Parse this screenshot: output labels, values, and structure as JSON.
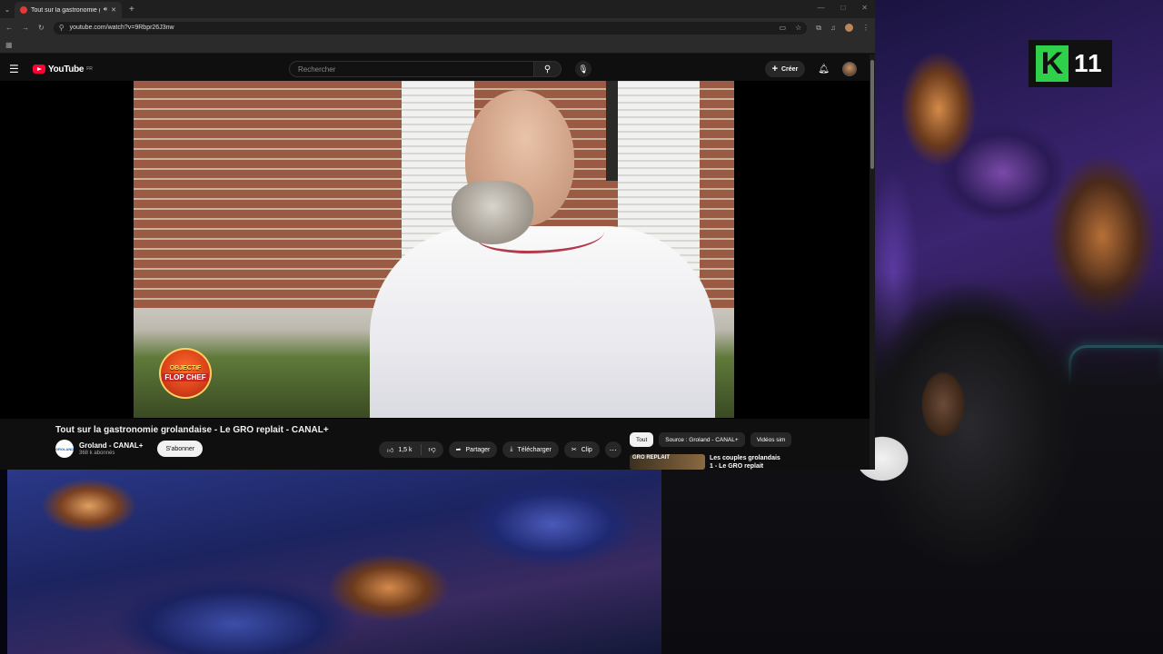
{
  "browser": {
    "tab_title": "Tout sur la gastronomie gr",
    "url": "youtube.com/watch?v=9Rbpr26J3nw"
  },
  "youtube": {
    "logo_text": "YouTube",
    "region": "FR",
    "search_placeholder": "Rechercher",
    "create_label": "Créer"
  },
  "video": {
    "overlay_badge_line1": "OBJECTIF",
    "overlay_badge_line2": "FLOP CHEF",
    "title": "Tout sur la gastronomie grolandaise - Le GRO replait - CANAL+",
    "channel_name": "Groland - CANAL+",
    "channel_avatar_text": "GROLAND",
    "subscribers": "368 k abonnés",
    "subscribe_label": "S'abonner",
    "likes": "1,5 k",
    "share_label": "Partager",
    "download_label": "Télécharger",
    "clip_label": "Clip"
  },
  "related": {
    "chips": [
      "Tout",
      "Source : Groland - CANAL+",
      "Vidéos sim"
    ],
    "first_item_thumb_text": "GRO REPLAIT",
    "first_item_title": "Les couples grolandais 1 - Le GRO replait"
  },
  "stream_overlay": {
    "logo_letter": "K",
    "logo_number": "11"
  },
  "colors": {
    "yt_red": "#ff0033",
    "k11_green": "#2fd14a",
    "page_bg": "#0f0f0f"
  }
}
